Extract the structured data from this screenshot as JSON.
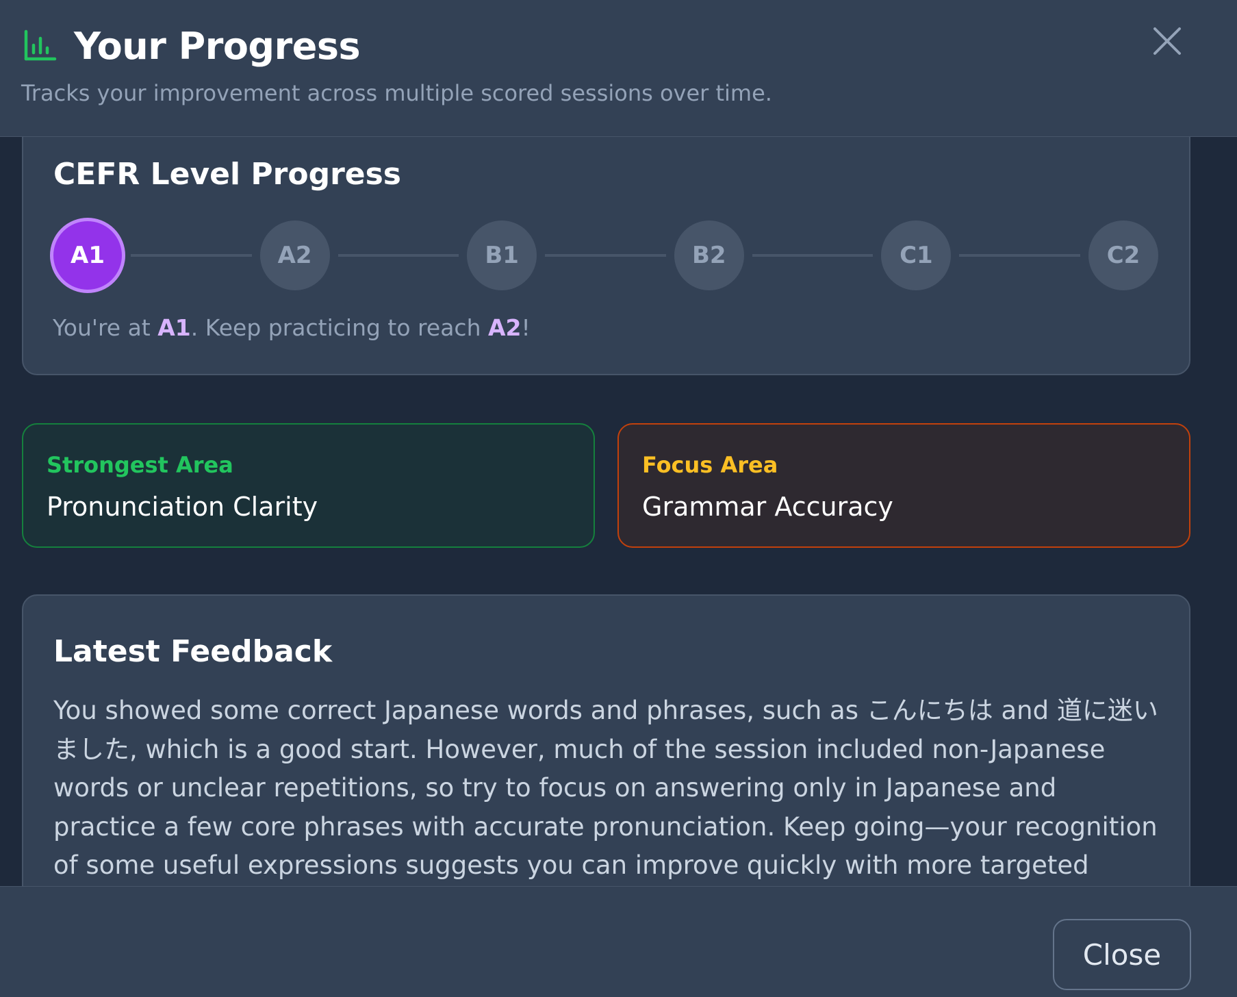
{
  "header": {
    "icon": "bar-chart-icon",
    "title": "Your Progress",
    "subtitle": "Tracks your improvement across multiple scored sessions over time.",
    "close_icon": "close-icon"
  },
  "cefr": {
    "title": "CEFR Level Progress",
    "levels": [
      "A1",
      "A2",
      "B1",
      "B2",
      "C1",
      "C2"
    ],
    "current_level": "A1",
    "next_level": "A2",
    "message_prefix": "You're at ",
    "message_middle": ". Keep practicing to reach ",
    "message_suffix": "!"
  },
  "strongest": {
    "label": "Strongest Area",
    "value": "Pronunciation Clarity"
  },
  "focus": {
    "label": "Focus Area",
    "value": "Grammar Accuracy"
  },
  "feedback": {
    "title": "Latest Feedback",
    "text": "You showed some correct Japanese words and phrases, such as こんにちは and 道に迷いました, which is a good start. However, much of the session included non-Japanese words or unclear repetitions, so try to focus on answering only in Japanese and practice a few core phrases with accurate pronunciation. Keep going—your recognition of some useful expressions suggests you can improve quickly with more targeted practice."
  },
  "footer": {
    "close_label": "Close"
  },
  "colors": {
    "accent_purple": "#9333ea",
    "accent_green": "#22c55e",
    "accent_amber": "#fbbf24"
  }
}
